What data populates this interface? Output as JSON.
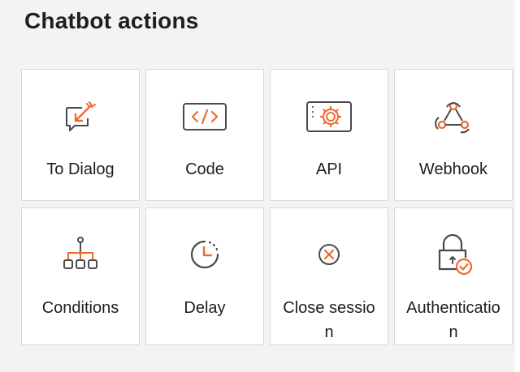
{
  "title": "Chatbot actions",
  "accent_color": "#ee6b2d",
  "actions": [
    {
      "label": "To Dialog",
      "icon": "dialog-arrow-icon"
    },
    {
      "label": "Code",
      "icon": "code-icon"
    },
    {
      "label": "API",
      "icon": "api-gear-icon"
    },
    {
      "label": "Webhook",
      "icon": "webhook-icon"
    },
    {
      "label": "Conditions",
      "icon": "conditions-tree-icon"
    },
    {
      "label": "Delay",
      "icon": "delay-clock-icon"
    },
    {
      "label": "Close session",
      "icon": "close-circle-icon"
    },
    {
      "label": "Authentication",
      "icon": "lock-check-icon"
    }
  ]
}
